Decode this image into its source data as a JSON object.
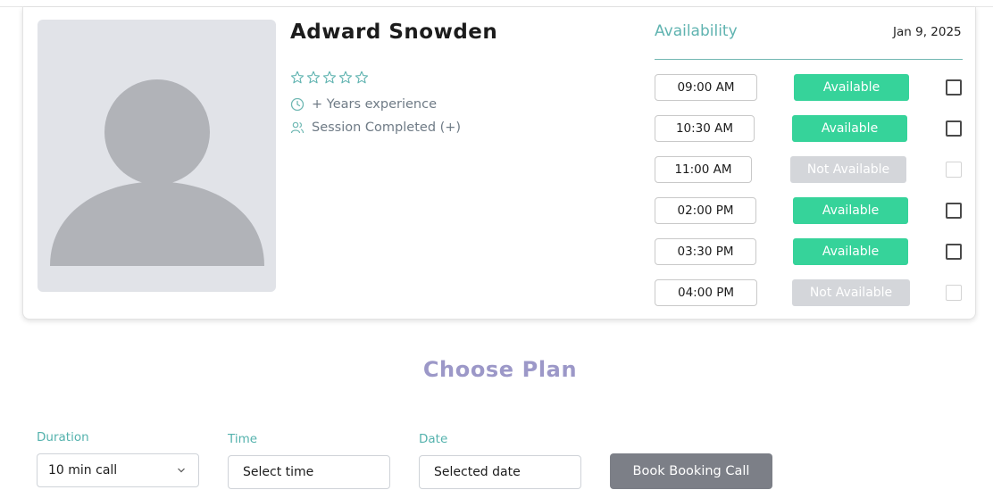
{
  "profile": {
    "name": "Adward Snowden",
    "rating_stars": 5,
    "rating_filled": 0,
    "experience": "+ Years experience",
    "sessions": "Session Completed (+)"
  },
  "availability": {
    "title": "Availability",
    "date": "Jan 9, 2025",
    "slots": [
      {
        "time": "09:00 AM",
        "status": "Available",
        "available": true
      },
      {
        "time": "10:30 AM",
        "status": "Available",
        "available": true
      },
      {
        "time": "11:00 AM",
        "status": "Not Available",
        "available": false
      },
      {
        "time": "02:00 PM",
        "status": "Available",
        "available": true
      },
      {
        "time": "03:30 PM",
        "status": "Available",
        "available": true
      },
      {
        "time": "04:00 PM",
        "status": "Not Available",
        "available": false
      }
    ]
  },
  "plan": {
    "title": "Choose Plan",
    "duration": {
      "label": "Duration",
      "value": "10 min call"
    },
    "time": {
      "label": "Time",
      "placeholder": "Select time"
    },
    "date": {
      "label": "Date",
      "placeholder": "Selected date"
    },
    "book_label": "Book Booking Call"
  },
  "colors": {
    "accent_teal": "#54b2ad",
    "available_green": "#36d39a",
    "unavailable_gray": "#d4d6da",
    "plan_title_purple": "#9c98c8",
    "button_gray": "#7c7f87"
  },
  "icons": {
    "rating": "star-outline-icon",
    "experience": "clock-icon",
    "sessions": "users-icon",
    "duration_dropdown": "chevron-down-icon",
    "photo_placeholder": "avatar-placeholder-icon"
  }
}
